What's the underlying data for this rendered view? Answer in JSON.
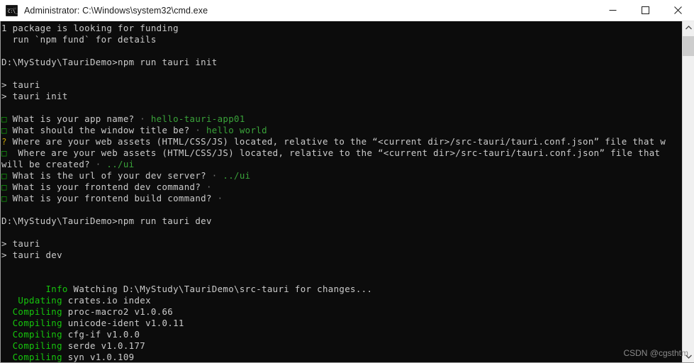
{
  "window": {
    "title": "Administrator:  C:\\Windows\\system32\\cmd.exe",
    "icon_name": "cmd-icon",
    "icon_glyph": "C:\\_",
    "controls": {
      "minimize_label": "Minimize",
      "maximize_label": "Maximize",
      "close_label": "Close"
    }
  },
  "console": {
    "background": "#0c0c0c",
    "foreground": "#cccccc",
    "accent_green": "#13a10e",
    "answer_green": "#3aa33a",
    "marker_yellow": "#c19c00",
    "lines": [
      {
        "segments": [
          {
            "text": "1 package is looking for funding",
            "class": "w"
          }
        ]
      },
      {
        "segments": [
          {
            "text": "  run `npm fund` for details",
            "class": "w"
          }
        ]
      },
      {
        "segments": [
          {
            "text": "",
            "class": "w"
          }
        ]
      },
      {
        "segments": [
          {
            "text": "D:\\MyStudy\\TauriDemo>npm run tauri init",
            "class": "w"
          }
        ]
      },
      {
        "segments": [
          {
            "text": "",
            "class": "w"
          }
        ]
      },
      {
        "segments": [
          {
            "text": "> tauri",
            "class": "w"
          }
        ]
      },
      {
        "segments": [
          {
            "text": "> tauri init",
            "class": "w"
          }
        ]
      },
      {
        "segments": [
          {
            "text": "",
            "class": "w"
          }
        ]
      },
      {
        "segments": [
          {
            "text": "□",
            "class": "box"
          },
          {
            "text": " What is your app name? ",
            "class": "w"
          },
          {
            "text": "·",
            "class": "dim"
          },
          {
            "text": " hello-tauri-app01",
            "class": "gd"
          }
        ]
      },
      {
        "segments": [
          {
            "text": "□",
            "class": "box"
          },
          {
            "text": " What should the window title be? ",
            "class": "w"
          },
          {
            "text": "·",
            "class": "dim"
          },
          {
            "text": " hello world",
            "class": "gd"
          }
        ]
      },
      {
        "segments": [
          {
            "text": "?",
            "class": "y"
          },
          {
            "text": " Where are your web assets (HTML/CSS/JS) located, relative to the “<current dir>/src-tauri/tauri.conf.json” file that w",
            "class": "w"
          }
        ]
      },
      {
        "segments": [
          {
            "text": "□",
            "class": "box"
          },
          {
            "text": "  Where are your web assets (HTML/CSS/JS) located, relative to the “<current dir>/src-tauri/tauri.conf.json” file that",
            "class": "w"
          }
        ]
      },
      {
        "segments": [
          {
            "text": "will be created? ",
            "class": "w"
          },
          {
            "text": "·",
            "class": "dim"
          },
          {
            "text": " ../ui",
            "class": "gd"
          }
        ]
      },
      {
        "segments": [
          {
            "text": "□",
            "class": "box"
          },
          {
            "text": " What is the url of your dev server? ",
            "class": "w"
          },
          {
            "text": "·",
            "class": "dim"
          },
          {
            "text": " ../ui",
            "class": "gd"
          }
        ]
      },
      {
        "segments": [
          {
            "text": "□",
            "class": "box"
          },
          {
            "text": " What is your frontend dev command? ",
            "class": "w"
          },
          {
            "text": "·",
            "class": "dim"
          }
        ]
      },
      {
        "segments": [
          {
            "text": "□",
            "class": "box"
          },
          {
            "text": " What is your frontend build command? ",
            "class": "w"
          },
          {
            "text": "·",
            "class": "dim"
          }
        ]
      },
      {
        "segments": [
          {
            "text": "",
            "class": "w"
          }
        ]
      },
      {
        "segments": [
          {
            "text": "D:\\MyStudy\\TauriDemo>npm run tauri dev",
            "class": "w"
          }
        ]
      },
      {
        "segments": [
          {
            "text": "",
            "class": "w"
          }
        ]
      },
      {
        "segments": [
          {
            "text": "> tauri",
            "class": "w"
          }
        ]
      },
      {
        "segments": [
          {
            "text": "> tauri dev",
            "class": "w"
          }
        ]
      },
      {
        "segments": [
          {
            "text": "",
            "class": "w"
          }
        ]
      },
      {
        "segments": [
          {
            "text": "",
            "class": "w"
          }
        ]
      },
      {
        "segments": [
          {
            "text": "        Info",
            "class": "g"
          },
          {
            "text": " Watching D:\\MyStudy\\TauriDemo\\src-tauri for changes...",
            "class": "w"
          }
        ]
      },
      {
        "segments": [
          {
            "text": "   Updating",
            "class": "g"
          },
          {
            "text": " crates.io index",
            "class": "w"
          }
        ]
      },
      {
        "segments": [
          {
            "text": "  Compiling",
            "class": "g"
          },
          {
            "text": " proc-macro2 v1.0.66",
            "class": "w"
          }
        ]
      },
      {
        "segments": [
          {
            "text": "  Compiling",
            "class": "g"
          },
          {
            "text": " unicode-ident v1.0.11",
            "class": "w"
          }
        ]
      },
      {
        "segments": [
          {
            "text": "  Compiling",
            "class": "g"
          },
          {
            "text": " cfg-if v1.0.0",
            "class": "w"
          }
        ]
      },
      {
        "segments": [
          {
            "text": "  Compiling",
            "class": "g"
          },
          {
            "text": " serde v1.0.177",
            "class": "w"
          }
        ]
      },
      {
        "segments": [
          {
            "text": "  Compiling",
            "class": "g"
          },
          {
            "text": " syn v1.0.109",
            "class": "w"
          }
        ]
      }
    ],
    "watermark": "CSDN @cgsthtm"
  },
  "scrollbar": {
    "up_label": "Scroll up",
    "down_label": "Scroll down",
    "thumb_label": "Scroll thumb"
  }
}
